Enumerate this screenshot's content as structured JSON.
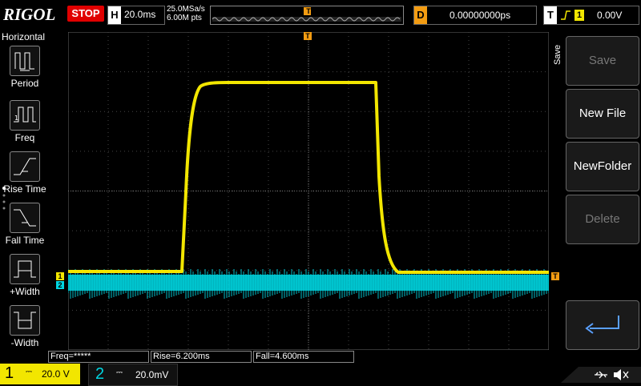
{
  "brand": "RIGOL",
  "run_state": "STOP",
  "horizontal": {
    "key": "H",
    "timebase": "20.0ms",
    "sample_rate": "25.0MSa/s",
    "memory_depth": "6.00M pts"
  },
  "delay": {
    "key": "D",
    "value": "0.00000000ps"
  },
  "trigger": {
    "key": "T",
    "source": "1",
    "level": "0.00V",
    "marker": "T"
  },
  "left_menu": {
    "title": "Horizontal",
    "items": [
      {
        "label": "Period"
      },
      {
        "label": "Freq"
      },
      {
        "label": "Rise Time"
      },
      {
        "label": "Fall Time"
      },
      {
        "label": "+Width"
      },
      {
        "label": "-Width"
      }
    ]
  },
  "right_menu": {
    "title": "Save",
    "buttons": [
      {
        "label": "Save",
        "enabled": false
      },
      {
        "label": "New File",
        "enabled": true
      },
      {
        "label": "NewFolder",
        "enabled": true
      },
      {
        "label": "Delete",
        "enabled": false
      }
    ]
  },
  "measurements": [
    {
      "text": "Freq=*****"
    },
    {
      "text": "Rise=6.200ms"
    },
    {
      "text": "Fall=4.600ms"
    }
  ],
  "channels": [
    {
      "num": "1",
      "coupling": "⎓",
      "scale": "20.0 V",
      "color": "#f2e600"
    },
    {
      "num": "2",
      "coupling": "⎓",
      "scale": "20.0mV",
      "color": "#00d5e0"
    }
  ],
  "colors": {
    "ch1": "#f2e600",
    "ch2": "#00d5e0",
    "trigger": "#f39c12",
    "stop": "#e00000"
  }
}
